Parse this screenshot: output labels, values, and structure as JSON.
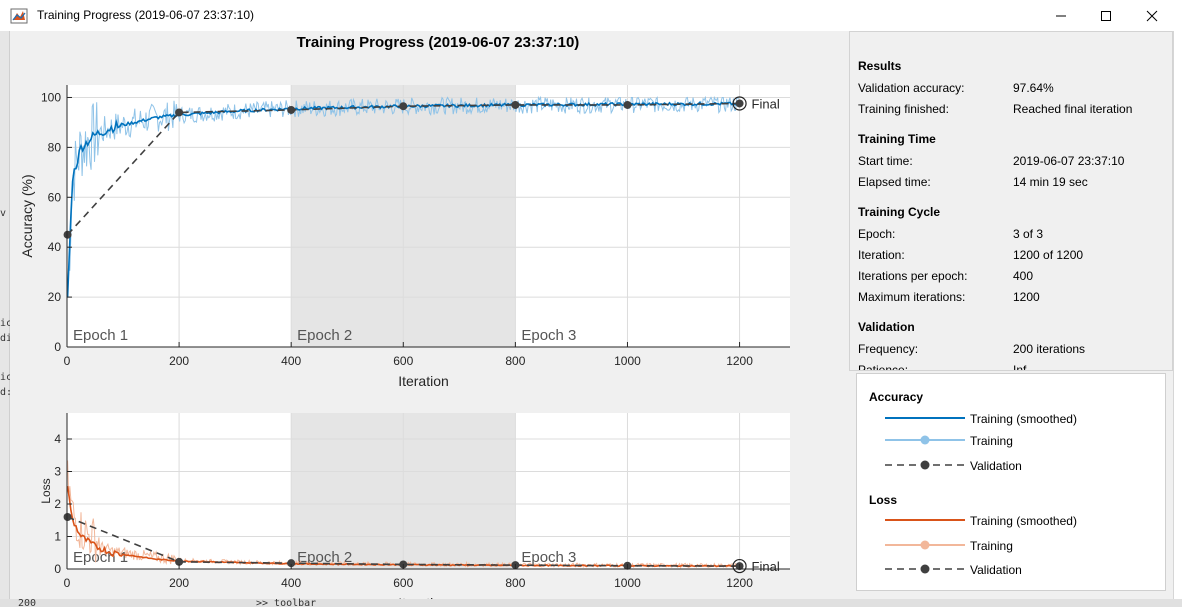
{
  "window": {
    "title": "Training Progress (2019-06-07 23:37:10)",
    "app_icon": "matlab-figure-icon"
  },
  "figure_title": "Training Progress (2019-06-07 23:37:10)",
  "colors": {
    "accuracy_smoothed": "#0072BD",
    "accuracy_raw": "#8fc3e8",
    "loss_smoothed": "#D95319",
    "loss_raw": "#f2b79a",
    "validation": "#404040",
    "epoch_shade": "#e5e5e5"
  },
  "epochs": [
    {
      "label": "Epoch 1",
      "start": 0,
      "end": 400
    },
    {
      "label": "Epoch 2",
      "start": 400,
      "end": 800
    },
    {
      "label": "Epoch 3",
      "start": 800,
      "end": 1200
    }
  ],
  "final_label": "Final",
  "chart_data": [
    {
      "type": "line",
      "name": "accuracy",
      "xlabel": "Iteration",
      "ylabel": "Accuracy (%)",
      "xlim": [
        0,
        1290
      ],
      "ylim": [
        0,
        105
      ],
      "xticks": [
        0,
        200,
        400,
        600,
        800,
        1000,
        1200
      ],
      "yticks": [
        0,
        20,
        40,
        60,
        80,
        100
      ],
      "validation": {
        "x": [
          1,
          200,
          400,
          600,
          800,
          1000,
          1200
        ],
        "y": [
          45,
          94,
          95,
          96.5,
          97,
          97,
          97.6
        ]
      },
      "smoothed_keypoints": {
        "x": [
          1,
          10,
          25,
          50,
          80,
          120,
          160,
          200,
          300,
          400,
          600,
          800,
          1000,
          1200
        ],
        "y": [
          20,
          68,
          80,
          85,
          88,
          90,
          92,
          93,
          94.5,
          95.5,
          96.5,
          97,
          97.3,
          97.5
        ]
      }
    },
    {
      "type": "line",
      "name": "loss",
      "xlabel": "Iteration",
      "ylabel": "Loss",
      "xlim": [
        0,
        1290
      ],
      "ylim": [
        0,
        4.8
      ],
      "xticks": [
        0,
        200,
        400,
        600,
        800,
        1000,
        1200
      ],
      "yticks": [
        0,
        1,
        2,
        3,
        4
      ],
      "validation": {
        "x": [
          1,
          200,
          400,
          600,
          800,
          1000,
          1200
        ],
        "y": [
          1.6,
          0.22,
          0.18,
          0.14,
          0.12,
          0.1,
          0.09
        ]
      },
      "smoothed_keypoints": {
        "x": [
          1,
          10,
          25,
          50,
          80,
          120,
          160,
          200,
          300,
          400,
          600,
          800,
          1000,
          1200
        ],
        "y": [
          2.5,
          1.5,
          1.0,
          0.7,
          0.5,
          0.4,
          0.3,
          0.25,
          0.2,
          0.16,
          0.13,
          0.11,
          0.1,
          0.09
        ]
      }
    }
  ],
  "results": {
    "title": "Results",
    "rows": [
      {
        "label": "Validation accuracy:",
        "value": "97.64%"
      },
      {
        "label": "Training finished:",
        "value": "Reached final iteration"
      }
    ]
  },
  "training_time": {
    "title": "Training Time",
    "rows": [
      {
        "label": "Start time:",
        "value": "2019-06-07 23:37:10"
      },
      {
        "label": "Elapsed time:",
        "value": "14 min 19 sec"
      }
    ]
  },
  "training_cycle": {
    "title": "Training Cycle",
    "rows": [
      {
        "label": "Epoch:",
        "value": "3 of 3"
      },
      {
        "label": "Iteration:",
        "value": "1200 of 1200"
      },
      {
        "label": "Iterations per epoch:",
        "value": "400"
      },
      {
        "label": "Maximum iterations:",
        "value": "1200"
      }
    ]
  },
  "validation_info": {
    "title": "Validation",
    "rows": [
      {
        "label": "Frequency:",
        "value": "200 iterations"
      },
      {
        "label": "Patience:",
        "value": "Inf"
      }
    ]
  },
  "legend": {
    "accuracy_title": "Accuracy",
    "loss_title": "Loss",
    "accuracy_items": [
      "Training (smoothed)",
      "Training",
      "Validation"
    ],
    "loss_items": [
      "Training (smoothed)",
      "Training",
      "Validation"
    ]
  },
  "background": {
    "left_fragments": [
      "v",
      "ic",
      "di",
      "ic",
      "d:"
    ],
    "bottom_fragment": ">> toolbar",
    "bottom_left_fragment": "200"
  }
}
